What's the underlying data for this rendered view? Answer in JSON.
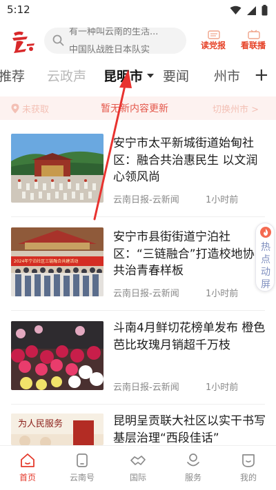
{
  "status_bar": {
    "time": "5:12"
  },
  "header": {
    "search_lines": [
      "有一种叫云南的生活...",
      "中国队战胜日本队实"
    ],
    "dang_button": "读党报",
    "lian_button": "看联播"
  },
  "tabs": [
    "推荐",
    "云政声",
    "昆明市",
    "要闻",
    "州市"
  ],
  "notice": {
    "location": "未获取",
    "message": "暂无新内容更新",
    "switch": "切换州市 >"
  },
  "news": [
    {
      "title": "安宁市太平新城街道始甸社区：融合共治惠民生 以文润心领风尚",
      "source": "云南日报-云新闻",
      "time": "1小时前"
    },
    {
      "title": "安宁市县街街道宁泊社区：“三链融合”打造校地协同共治青春样板",
      "source": "云南日报-云新闻",
      "time": "1小时前"
    },
    {
      "title": "斗南4月鲜切花榜单发布 橙色芭比玫瑰月销超千万枝",
      "source": "云南日报-云新闻",
      "time": "1小时前"
    },
    {
      "title": "昆明呈贡联大社区以实干书写基层治理“西段佳话”",
      "source": "",
      "time": ""
    }
  ],
  "thumb_texts": {
    "banner_red": "2024年宁泊社区三链融合共建活动",
    "calligraphy": "为人民服务"
  },
  "hot_button": "热点动屏",
  "bottom_nav": [
    "首页",
    "云南号",
    "国际",
    "服务",
    "我的"
  ],
  "colors": {
    "brand_red": "#e4392b",
    "notice_bg": "#fdf2f0",
    "arrow_red": "#e8322f"
  }
}
